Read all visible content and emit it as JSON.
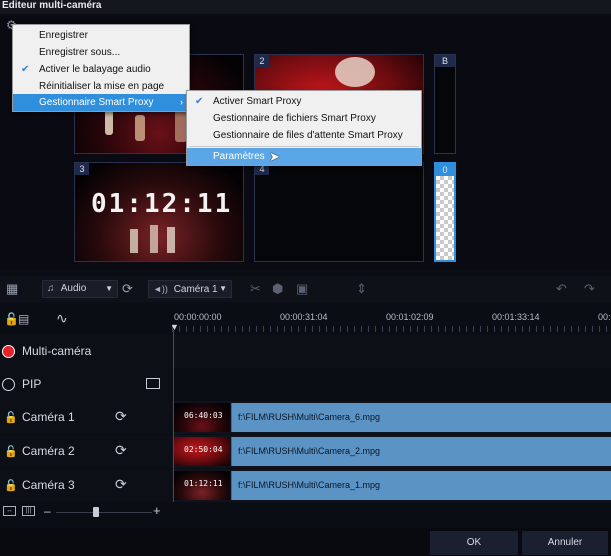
{
  "window": {
    "title": "Editeur multi-caméra"
  },
  "preview": {
    "tiles": [
      {
        "num": ""
      },
      {
        "num": "2"
      },
      {
        "num": "B"
      },
      {
        "num": "3",
        "timecode": "01:12:11"
      },
      {
        "num": "4"
      },
      {
        "num": "0"
      }
    ]
  },
  "menu": {
    "items": [
      {
        "label": "Enregistrer"
      },
      {
        "label": "Enregistrer sous..."
      },
      {
        "label": "Activer le balayage audio",
        "check": "✔"
      },
      {
        "label": "Réinitialiser la mise en page"
      },
      {
        "label": "Gestionnaire Smart Proxy",
        "arrow": "›"
      }
    ],
    "submenu": [
      {
        "label": "Activer Smart Proxy",
        "check": "✔"
      },
      {
        "label": "Gestionnaire de fichiers Smart Proxy"
      },
      {
        "label": "Gestionnaire de files d'attente Smart Proxy"
      },
      {
        "label": "Paramètres"
      }
    ]
  },
  "toolbar": {
    "audio_label": "Audio",
    "camera_label": "Caméra 1",
    "audio_prefix": "♫",
    "camera_prefix": "◄))"
  },
  "ruler": {
    "labels": [
      "00:00:00:00",
      "00:00:31:04",
      "00:01:02:09",
      "00:01:33:14",
      "00:0"
    ]
  },
  "tracks": [
    {
      "name": "Multi-caméra"
    },
    {
      "name": "PIP"
    },
    {
      "name": "Caméra 1",
      "clip": "f:\\FILM\\RUSH\\Multi\\Camera_6.mpg",
      "thumb_tc": "06:40:03"
    },
    {
      "name": "Caméra 2",
      "clip": "f:\\FILM\\RUSH\\Multi\\Camera_2.mpg",
      "thumb_tc": "02:50:04"
    },
    {
      "name": "Caméra 3",
      "clip": "f:\\FILM\\RUSH\\Multi\\Camera_1.mpg",
      "thumb_tc": "01:12:11"
    }
  ],
  "footer": {
    "ok_label": "OK",
    "cancel_label": "Annuler"
  },
  "colors": {
    "accent": "#2f8fdc",
    "clip": "#5b93c4",
    "record": "#e0242a"
  }
}
